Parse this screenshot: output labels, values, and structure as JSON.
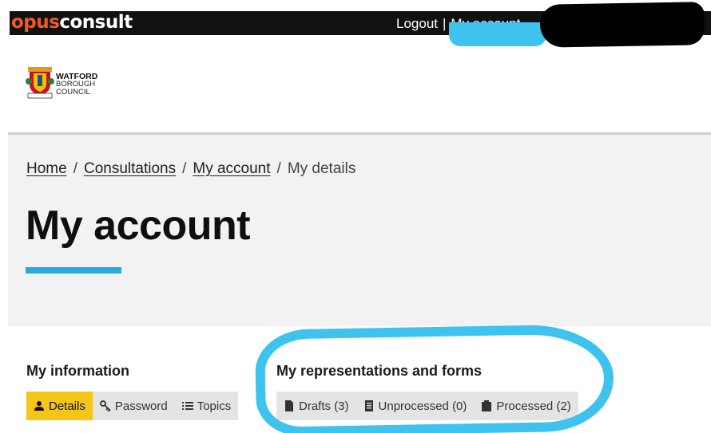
{
  "topbar": {
    "brand_part1": "opus",
    "brand_part2": "consult",
    "logout": "Logout",
    "separator": "|",
    "my_account": "My account"
  },
  "council_logo": {
    "line1": "WATFORD",
    "line2": "BOROUGH",
    "line3": "COUNCIL"
  },
  "breadcrumb": {
    "items": [
      "Home",
      "Consultations",
      "My account"
    ],
    "separator": "/",
    "current": "My details"
  },
  "page_title": "My account",
  "my_information": {
    "heading": "My information",
    "tabs": [
      {
        "label": "Details",
        "icon": "user-icon",
        "active": true
      },
      {
        "label": "Password",
        "icon": "key-icon",
        "active": false
      },
      {
        "label": "Topics",
        "icon": "list-icon",
        "active": false
      }
    ]
  },
  "my_representations": {
    "heading": "My representations and forms",
    "tabs": [
      {
        "label": "Drafts (3)",
        "icon": "file-icon"
      },
      {
        "label": "Unprocessed (0)",
        "icon": "document-icon"
      },
      {
        "label": "Processed (2)",
        "icon": "clipboard-icon"
      }
    ]
  },
  "colors": {
    "brand_orange": "#f15a22",
    "accent_blue": "#29abe2",
    "active_tab": "#f5c518",
    "annotation": "#3ec3ee"
  }
}
